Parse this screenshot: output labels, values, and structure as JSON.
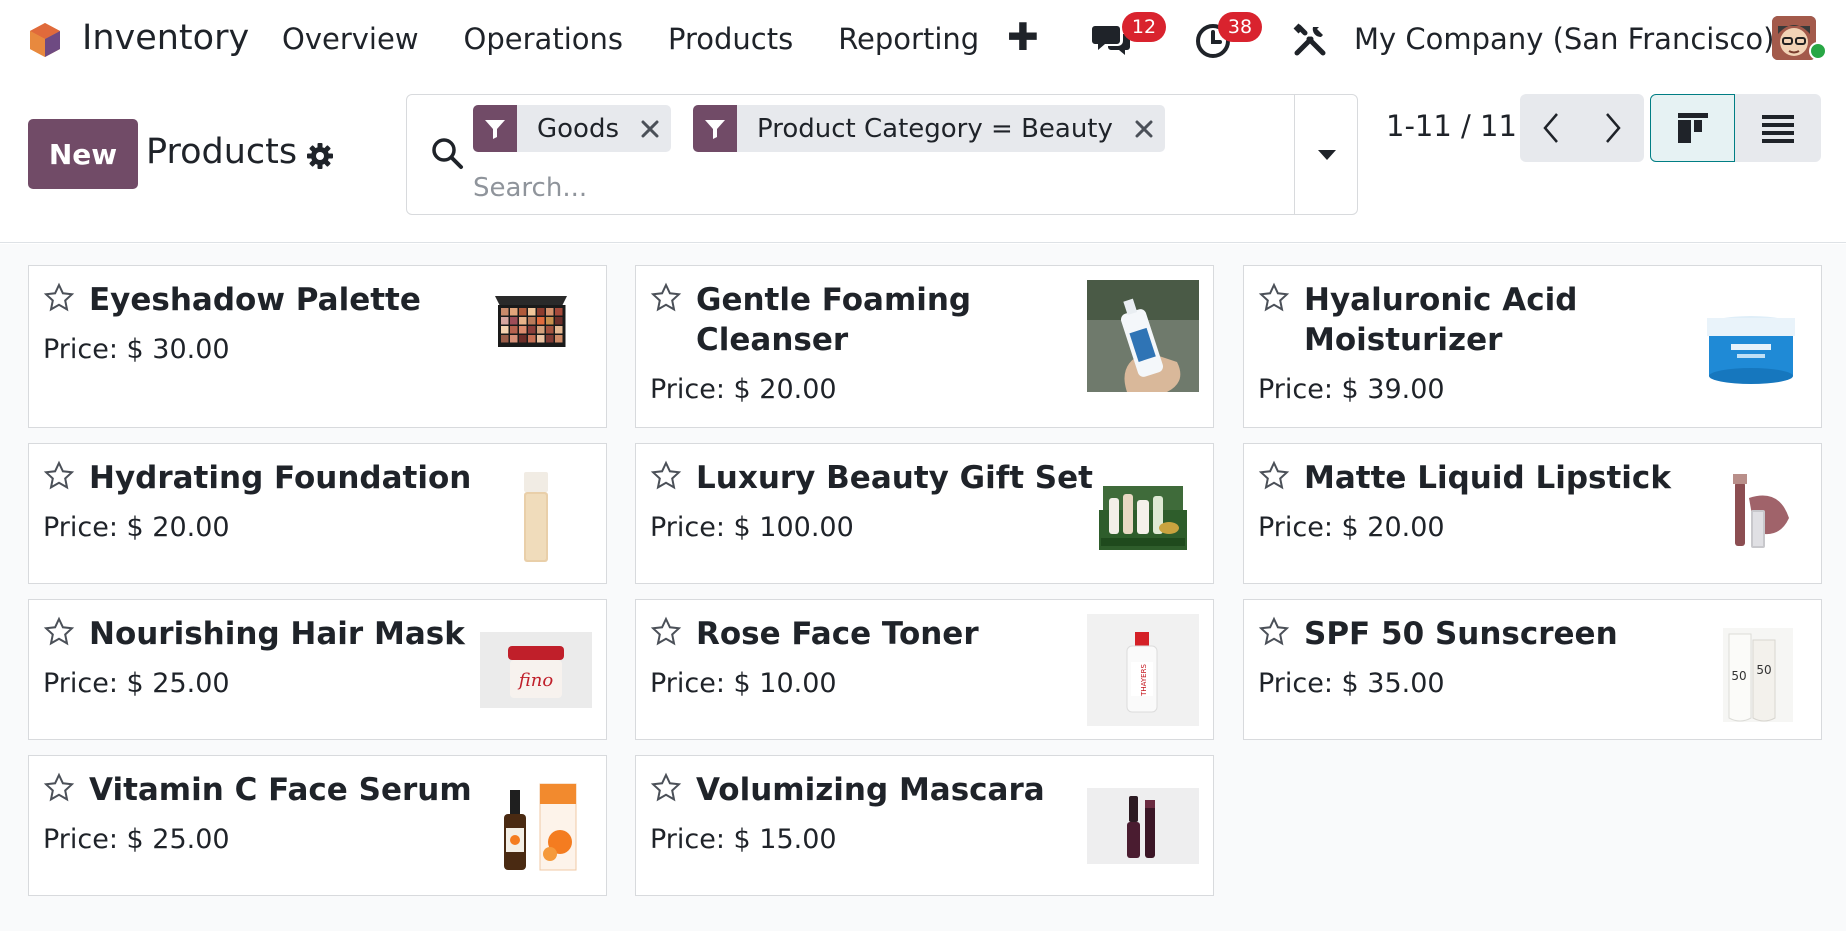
{
  "navbar": {
    "app_title": "Inventory",
    "menu": [
      "Overview",
      "Operations",
      "Products",
      "Reporting"
    ],
    "plus_label": "✚",
    "messages_count": "12",
    "activities_count": "38",
    "company": "My Company (San Francisco)"
  },
  "control": {
    "new_label": "New",
    "page_title": "Products",
    "search_placeholder": "Search...",
    "facets": [
      "Goods",
      "Product Category = Beauty"
    ],
    "pager": "1-11 / 11"
  },
  "colors": {
    "brand": "#714b67",
    "badge": "#d9232e",
    "accent": "#017e84"
  },
  "products": [
    {
      "name": "Eyeshadow Palette",
      "price": "Price: $ 30.00",
      "image": "eyeshadow-palette"
    },
    {
      "name": "Gentle Foaming Cleanser",
      "price": "Price: $ 20.00",
      "image": "cleanser-bottle"
    },
    {
      "name": "Hyaluronic Acid Moisturizer",
      "price": "Price: $ 39.00",
      "image": "moisturizer-jar"
    },
    {
      "name": "Hydrating Foundation",
      "price": "Price: $ 20.00",
      "image": "foundation-bottle"
    },
    {
      "name": "Luxury Beauty Gift Set",
      "price": "Price: $ 100.00",
      "image": "gift-set"
    },
    {
      "name": "Matte Liquid Lipstick",
      "price": "Price: $ 20.00",
      "image": "lipstick"
    },
    {
      "name": "Nourishing Hair Mask",
      "price": "Price: $ 25.00",
      "image": "hair-mask"
    },
    {
      "name": "Rose Face Toner",
      "price": "Price: $ 10.00",
      "image": "toner-bottle"
    },
    {
      "name": "SPF 50 Sunscreen",
      "price": "Price: $ 35.00",
      "image": "sunscreen-tubes"
    },
    {
      "name": "Vitamin C Face Serum",
      "price": "Price: $ 25.00",
      "image": "serum-bottle"
    },
    {
      "name": "Volumizing Mascara",
      "price": "Price: $ 15.00",
      "image": "mascara"
    }
  ]
}
